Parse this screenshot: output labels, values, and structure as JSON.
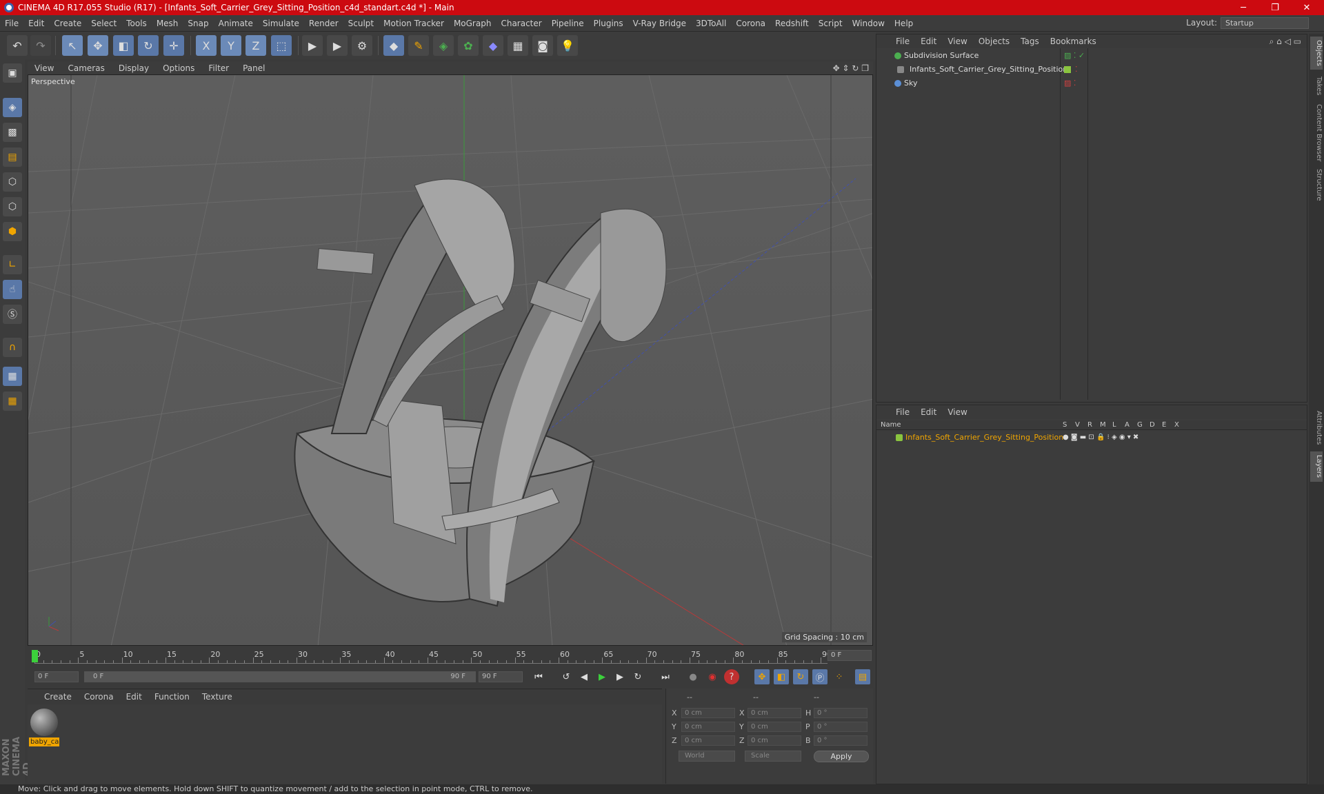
{
  "window": {
    "title": "CINEMA 4D R17.055 Studio (R17) - [Infants_Soft_Carrier_Grey_Sitting_Position_c4d_standart.c4d *] - Main",
    "minimize": "─",
    "maximize": "❐",
    "close": "✕"
  },
  "menu": [
    "File",
    "Edit",
    "Create",
    "Select",
    "Tools",
    "Mesh",
    "Snap",
    "Animate",
    "Simulate",
    "Render",
    "Sculpt",
    "Motion Tracker",
    "MoGraph",
    "Character",
    "Pipeline",
    "Plugins",
    "V-Ray Bridge",
    "3DToAll",
    "Corona",
    "Redshift",
    "Script",
    "Window",
    "Help"
  ],
  "layout": {
    "label": "Layout:",
    "value": "Startup"
  },
  "toolbar": {
    "undo": "↶",
    "redo": "↷",
    "select": "↖",
    "move": "✥",
    "scale": "◧",
    "rotate": "↻",
    "live": "✛",
    "x": "X",
    "y": "Y",
    "z": "Z",
    "coord": "⬚",
    "render_view": "▶",
    "render_pic": "▶",
    "render_settings": "⚙",
    "cube": "◆",
    "pen": "✎",
    "subdiv": "◈",
    "cloner": "✿",
    "deformer": "◆",
    "floor": "▦",
    "camera": "◙",
    "light": "💡"
  },
  "viewport": {
    "menu": [
      "View",
      "Cameras",
      "Display",
      "Options",
      "Filter",
      "Panel"
    ],
    "label": "Perspective",
    "grid_spacing": "Grid Spacing : 10 cm"
  },
  "timeline": {
    "ticks": [
      "0",
      "5",
      "10",
      "15",
      "20",
      "25",
      "30",
      "35",
      "40",
      "45",
      "50",
      "55",
      "60",
      "65",
      "70",
      "75",
      "80",
      "85",
      "90"
    ],
    "current": "0 F",
    "start": "0 F",
    "range_start": "0 F",
    "range_end": "90 F",
    "end": "90 F"
  },
  "transport": {
    "first": "⏮",
    "prev_key": "↺",
    "prev": "◀",
    "play": "▶",
    "next": "▶",
    "loop": "↻",
    "last": "⏭",
    "rec": "●",
    "autokey": "◉",
    "help": "?"
  },
  "materials": {
    "menu": [
      "Create",
      "Corona",
      "Edit",
      "Function",
      "Texture"
    ],
    "items": [
      {
        "name": "baby_ca"
      }
    ]
  },
  "coords": {
    "headers": [
      "--",
      "--",
      "--"
    ],
    "rows": [
      {
        "a": "X",
        "av": "0 cm",
        "b": "X",
        "bv": "0 cm",
        "c": "H",
        "cv": "0 °"
      },
      {
        "a": "Y",
        "av": "0 cm",
        "b": "Y",
        "bv": "0 cm",
        "c": "P",
        "cv": "0 °"
      },
      {
        "a": "Z",
        "av": "0 cm",
        "b": "Z",
        "bv": "0 cm",
        "c": "B",
        "cv": "0 °"
      }
    ],
    "space": "World",
    "mode": "Scale",
    "apply": "Apply"
  },
  "objects": {
    "menu": [
      "File",
      "Edit",
      "View",
      "Objects",
      "Tags",
      "Bookmarks"
    ],
    "items": [
      {
        "name": "Subdivision Surface",
        "color": "#4caf50"
      },
      {
        "name": "Infants_Soft_Carrier_Grey_Sitting_Position",
        "color": "#8ac43f"
      },
      {
        "name": "Sky",
        "color": "#5b8fd6"
      }
    ]
  },
  "layers": {
    "menu": [
      "File",
      "Edit",
      "View"
    ],
    "header": {
      "name": "Name",
      "cols": [
        "S",
        "V",
        "R",
        "M",
        "L",
        "A",
        "G",
        "D",
        "E",
        "X"
      ]
    },
    "items": [
      {
        "name": "Infants_Soft_Carrier_Grey_Sitting_Position",
        "color": "#f0a500"
      }
    ]
  },
  "right_tabs": [
    "Objects",
    "Takes",
    "Content Browser",
    "Structure",
    "Attributes",
    "Layers"
  ],
  "brand": "MAXON CINEMA 4D",
  "status": "Move: Click and drag to move elements. Hold down SHIFT to quantize movement / add to the selection in point mode, CTRL to remove."
}
